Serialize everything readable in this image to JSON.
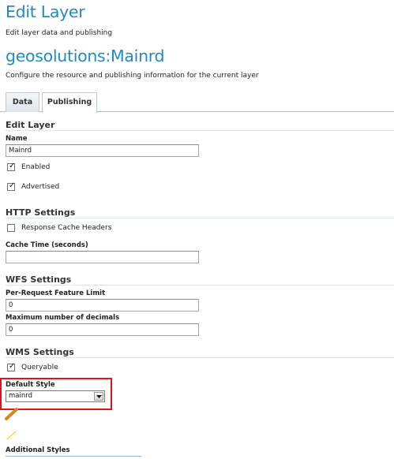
{
  "header": {
    "title": "Edit Layer",
    "subtitle": "Edit layer data and publishing",
    "layer_name": "geosolutions:Mainrd",
    "layer_description": "Configure the resource and publishing information for the current layer"
  },
  "tabs": [
    {
      "label": "Data",
      "active": false
    },
    {
      "label": "Publishing",
      "active": true
    }
  ],
  "edit_layer": {
    "heading": "Edit Layer",
    "name_label": "Name",
    "name_value": "Mainrd",
    "enabled_label": "Enabled",
    "enabled_checked": true,
    "advertised_label": "Advertised",
    "advertised_checked": true
  },
  "http_settings": {
    "heading": "HTTP Settings",
    "cache_headers_label": "Response Cache Headers",
    "cache_headers_checked": false,
    "cache_time_label": "Cache Time (seconds)",
    "cache_time_value": ""
  },
  "wfs_settings": {
    "heading": "WFS Settings",
    "feature_limit_label": "Per-Request Feature Limit",
    "feature_limit_value": "0",
    "max_decimals_label": "Maximum number of decimals",
    "max_decimals_value": "0"
  },
  "wms_settings": {
    "heading": "WMS Settings",
    "queryable_label": "Queryable",
    "queryable_checked": true,
    "default_style_label": "Default Style",
    "default_style_value": "mainrd",
    "additional_styles_label": "Additional Styles"
  },
  "icons": {
    "checkmark": "check-icon",
    "dropdown": "chevron-down-icon",
    "style_preview": "brush-icon",
    "line_preview": "line-symbol-icon"
  },
  "colors": {
    "accent": "#1f8ac6",
    "highlight": "#e3131a",
    "brush": "#d08a1c",
    "line_symbol": "#f1e02a"
  }
}
